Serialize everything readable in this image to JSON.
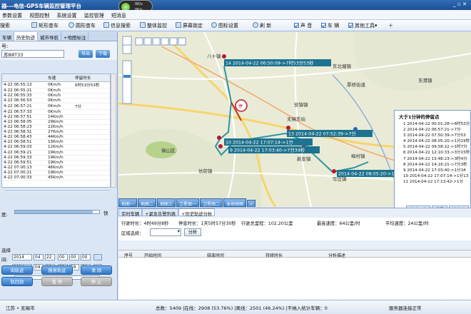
{
  "app": {
    "title": "器---电信-GPS车辆监控管理平台",
    "window_controls": "_ ▫ ✕",
    "net_up": "0K/s",
    "net_down": "0K/s"
  },
  "menu": [
    "参数设置",
    "视图控制",
    "系统设置",
    "监控管理",
    "短消息"
  ],
  "toolbar": {
    "search": "搜索",
    "rect_search": "矩形查车",
    "circle_search": "圆形查车",
    "info_search": "信息搜索",
    "overall_monitor": "整体监控",
    "lock_screen": "屏幕锁定",
    "icon_settings": "图标设置",
    "refresh": "刷 新",
    "sound": "声 音",
    "vehicle": "车 辆",
    "other_tools": "其他工具▾"
  },
  "left": {
    "tabs": [
      "车辆",
      "历史轨迹",
      "城市导航",
      "+地图标注"
    ],
    "plate_label": "号:",
    "plate_value": "苏B8T33",
    "export_btn": "导出",
    "download_btn": "下载",
    "table_headers": [
      "",
      "车速",
      "停留时长"
    ],
    "rows": [
      {
        "t": "4-22 06:55:13",
        "s": "0Km/h",
        "d": "6时53分53秒"
      },
      {
        "t": "4-22 06:55:21",
        "s": "0Km/h",
        "d": ""
      },
      {
        "t": "4-22 06:55:33",
        "s": "0Km/h",
        "d": ""
      },
      {
        "t": "4-22 06:56:53",
        "s": "0Km/h",
        "d": ""
      },
      {
        "t": "4-22 06:57:21",
        "s": "0Km/h",
        "d": "7分"
      },
      {
        "t": "4-22 06:57:33",
        "s": "0Km/h",
        "d": ""
      },
      {
        "t": "4-22 06:57:51",
        "s": "14Km/h",
        "d": ""
      },
      {
        "t": "4-22 06:58:05",
        "s": "29Km/h",
        "d": ""
      },
      {
        "t": "4-22 06:58:23",
        "s": "22Km/h",
        "d": ""
      },
      {
        "t": "4-22 06:58:31",
        "s": "27Km/h",
        "d": ""
      },
      {
        "t": "4-22 06:58:43",
        "s": "44Km/h",
        "d": ""
      },
      {
        "t": "4-22 06:58:51",
        "s": "13Km/h",
        "d": ""
      },
      {
        "t": "4-22 06:59:03",
        "s": "12Km/h",
        "d": ""
      },
      {
        "t": "4-22 06:59:21",
        "s": "19Km/h",
        "d": ""
      },
      {
        "t": "4-22 06:59:33",
        "s": "19Km/h",
        "d": ""
      },
      {
        "t": "4-22 06:59:51",
        "s": "19Km/h",
        "d": ""
      },
      {
        "t": "4-22 07:00:13",
        "s": "46Km/h",
        "d": ""
      },
      {
        "t": "4-22 07:00:21",
        "s": "19Km/h",
        "d": ""
      },
      {
        "t": "4-22 07:00:33",
        "s": "45Km/h",
        "d": ""
      }
    ],
    "speed_label": "度:",
    "speed_fast": "快",
    "select_label": "选择",
    "start_label": "间:",
    "start_date": [
      "2014",
      "04",
      "22"
    ],
    "start_time": [
      "00",
      "00",
      "00"
    ],
    "end_label": "间:",
    "end_date": [
      "2014",
      "04",
      "22"
    ],
    "end_time": [
      "23",
      "59",
      "59"
    ],
    "range_label": "择:",
    "btn_query": "询轨迹",
    "btn_follow": "随意轨迹",
    "btn_clear": "清 除",
    "btn_playback": "轨回放",
    "btn_pause": "暂 停",
    "btn_stop": "停 止",
    "speed_level": 0.92
  },
  "map": {
    "labels": [
      "八十镇",
      "安镇镇",
      "无锡东站",
      "锡山区",
      "坊前镇",
      "东北塘镇",
      "厚桥街道",
      "东港镇",
      "梅村镇",
      "华庄镇",
      "新安镇"
    ],
    "callouts": [
      "14 2014-04-22 06:50:09->7时53分53秒",
      "13 2014-04-22 07:52:39->7分",
      "10 2014-04-22 17:07:14->1分",
      "9 2014-04-22 17:03:40->7分34秒",
      "2014-04-22 08:05:20->1分"
    ],
    "tabs": [
      "地图一",
      "地图二",
      "地图三",
      "卫星图一",
      "卫星图二",
      "本地地图"
    ],
    "tabs_more": "«"
  },
  "stop_panel": {
    "title": "大于1分钟的停留点",
    "rows": [
      "1  2014-04-22  00:01:28->6时53分",
      "2  2014-04-22  06:57:21->7分",
      "3  2014-04-22  07:50:39->7分53",
      "4  2014-04-22  08:05:20->1分19秒",
      "5  2014-04-22  09:58:22->1时7分",
      "6  2014-04-22  12:10:33->3分15秒",
      "7  2014-04-22  13:48:23->3时4分",
      "8  2014-04-22  14:16:21->7分3秒",
      "9  2014-04-22  17:03:40->1分34",
      "10 2014-04-22  17:07:14->1分13",
      "11 2014-04-22  17:13:42->1分"
    ],
    "btn_center": "轨迹居中",
    "btn_settings": "设置",
    "btn_stop": "停留点"
  },
  "bottom": {
    "tabs": [
      "实时车辆",
      "+紧急告警列表",
      "+历史轨迹分析"
    ],
    "stats": [
      "行驶时长：4时49分8秒",
      "停息时长：1天5时57分30秒",
      "行驶总里程：102.20公里",
      "最高速度：64公里/时",
      "平均速度：24公里/时"
    ],
    "area_label": "区域选择：",
    "analyze_btn": "分析",
    "headers": [
      "序号",
      "开始时间",
      "结束时间",
      "持续时长",
      "分析描述"
    ]
  },
  "status": {
    "location": "江苏 • 无锡市",
    "totals": "总数：5409 |在线：2908 (53.76%) |离线：2501 (46.24%) |不纳入统计车辆：0",
    "server": "服务器连接正常"
  },
  "colors": {
    "accent": "#2f77c6",
    "route": "#2a95a8",
    "pin": "#c0142e"
  }
}
